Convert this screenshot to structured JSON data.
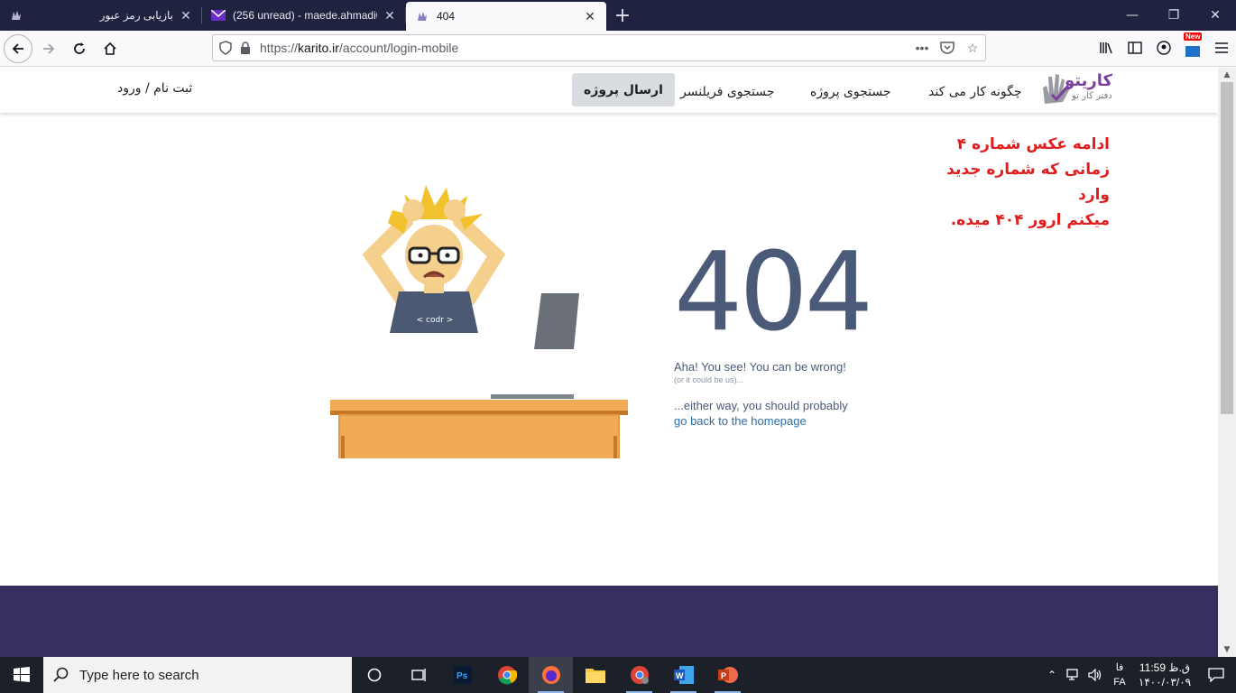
{
  "browser": {
    "tabs": [
      {
        "title": "بازیابی رمز عبور",
        "active": false
      },
      {
        "title": "(256 unread) - maede.ahmadi0",
        "active": false
      },
      {
        "title": "404",
        "active": true
      }
    ],
    "new_tab": "+",
    "url_prefix": "https://",
    "url_host": "karito.ir",
    "url_path": "/account/login-mobile",
    "new_badge": "New"
  },
  "site": {
    "logo_brand": "کاریتو",
    "logo_tagline": "دفتر کار تو",
    "nav": {
      "how": "چگونه کار می کند",
      "projects": "جستجوی پروژه",
      "freelancers": "جستجوی فریلنسر",
      "send_project": "ارسال پروژه",
      "auth": "ثبت نام / ورود"
    },
    "note_lines": [
      "ادامه عکس شماره ۴",
      "زمانی که شماره جدید وارد",
      "میکنم ارور ۴۰۴ میده."
    ],
    "error": {
      "code": "404",
      "line1": "Aha! You see! You can be wrong!",
      "line2": "(or it could be us)...",
      "line3": "...either way, you should probably",
      "link": "go back to the homepage"
    },
    "illustration_shirt_text": "< codr >"
  },
  "taskbar": {
    "search_placeholder": "Type here to search",
    "lang_top": "فا",
    "lang_bottom": "FA",
    "time": "11:59 ق.ظ",
    "date": "۱۴۰۰/۰۳/۰۹"
  }
}
